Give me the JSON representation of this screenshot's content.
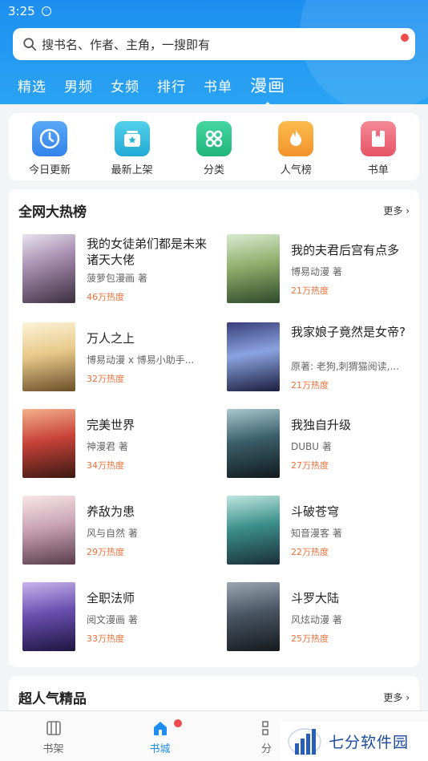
{
  "status": {
    "time": "3:25"
  },
  "search": {
    "placeholder": "搜书名、作者、主角，一搜即有"
  },
  "tabs": [
    {
      "label": "精选"
    },
    {
      "label": "男频"
    },
    {
      "label": "女频"
    },
    {
      "label": "排行"
    },
    {
      "label": "书单"
    },
    {
      "label": "漫画"
    }
  ],
  "quick": [
    {
      "label": "今日更新",
      "icon": "clock-icon",
      "color": "#3b8ff0"
    },
    {
      "label": "最新上架",
      "icon": "star-box-icon",
      "color": "#2bb8d8"
    },
    {
      "label": "分类",
      "icon": "grid-icon",
      "color": "#27c08a"
    },
    {
      "label": "人气榜",
      "icon": "flame-icon",
      "color": "#f5a23a"
    },
    {
      "label": "书单",
      "icon": "booklist-icon",
      "color": "#ef6b7b"
    }
  ],
  "hot": {
    "title": "全网大热榜",
    "more": "更多",
    "books": [
      {
        "title": "我的女徒弟们都是未来诸天大佬",
        "author": "菠萝包漫画 著",
        "heat": "46万热度"
      },
      {
        "title": "我的夫君后宫有点多",
        "author": "博易动漫 著",
        "heat": "21万热度"
      },
      {
        "title": "万人之上",
        "author": "博易动漫 x 博易小助手...",
        "heat": "32万热度"
      },
      {
        "title": "我家娘子竟然是女帝?",
        "author": "原著: 老狗,刺猬猫阅读,...",
        "heat": "21万热度"
      },
      {
        "title": "完美世界",
        "author": "神漫君 著",
        "heat": "34万热度"
      },
      {
        "title": "我独自升级",
        "author": "DUBU 著",
        "heat": "27万热度"
      },
      {
        "title": "养敌为患",
        "author": "风与自然 著",
        "heat": "29万热度"
      },
      {
        "title": "斗破苍穹",
        "author": "知音漫客 著",
        "heat": "22万热度"
      },
      {
        "title": "全职法师",
        "author": "阅文漫画 著",
        "heat": "33万热度"
      },
      {
        "title": "斗罗大陆",
        "author": "风炫动漫 著",
        "heat": "25万热度"
      }
    ]
  },
  "popular": {
    "title": "超人气精品",
    "more": "更多"
  },
  "nav": [
    {
      "label": "书架"
    },
    {
      "label": "书城"
    },
    {
      "label": "分"
    }
  ],
  "watermark": {
    "text": "七分软件园"
  }
}
